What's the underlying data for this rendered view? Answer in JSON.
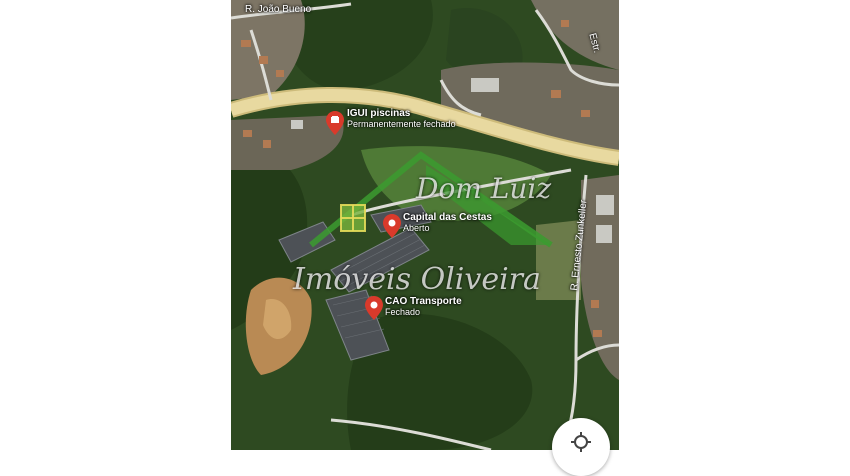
{
  "map": {
    "streets": {
      "rua_joao_bueno": "R. João Bueno",
      "rua_ernesto_zunkeller": "R. Ernesto Zunkeller",
      "top_right_fragment": "Estr."
    },
    "places": [
      {
        "id": "igui",
        "name": "IGUI piscinas",
        "status": "Permanentemente fechado"
      },
      {
        "id": "capital",
        "name": "Capital das Cestas",
        "status": "Aberto"
      },
      {
        "id": "cao",
        "name": "CAO Transporte",
        "status": "Fechado"
      }
    ],
    "watermark": {
      "line1": "Dom Luiz",
      "line2": "Imóveis Oliveira"
    },
    "controls": {
      "locate_icon": "crosshair-icon"
    },
    "colors": {
      "pin": "#d93a2b",
      "road": "#e8d9a0",
      "logo_green": "#3b9b2f"
    }
  }
}
